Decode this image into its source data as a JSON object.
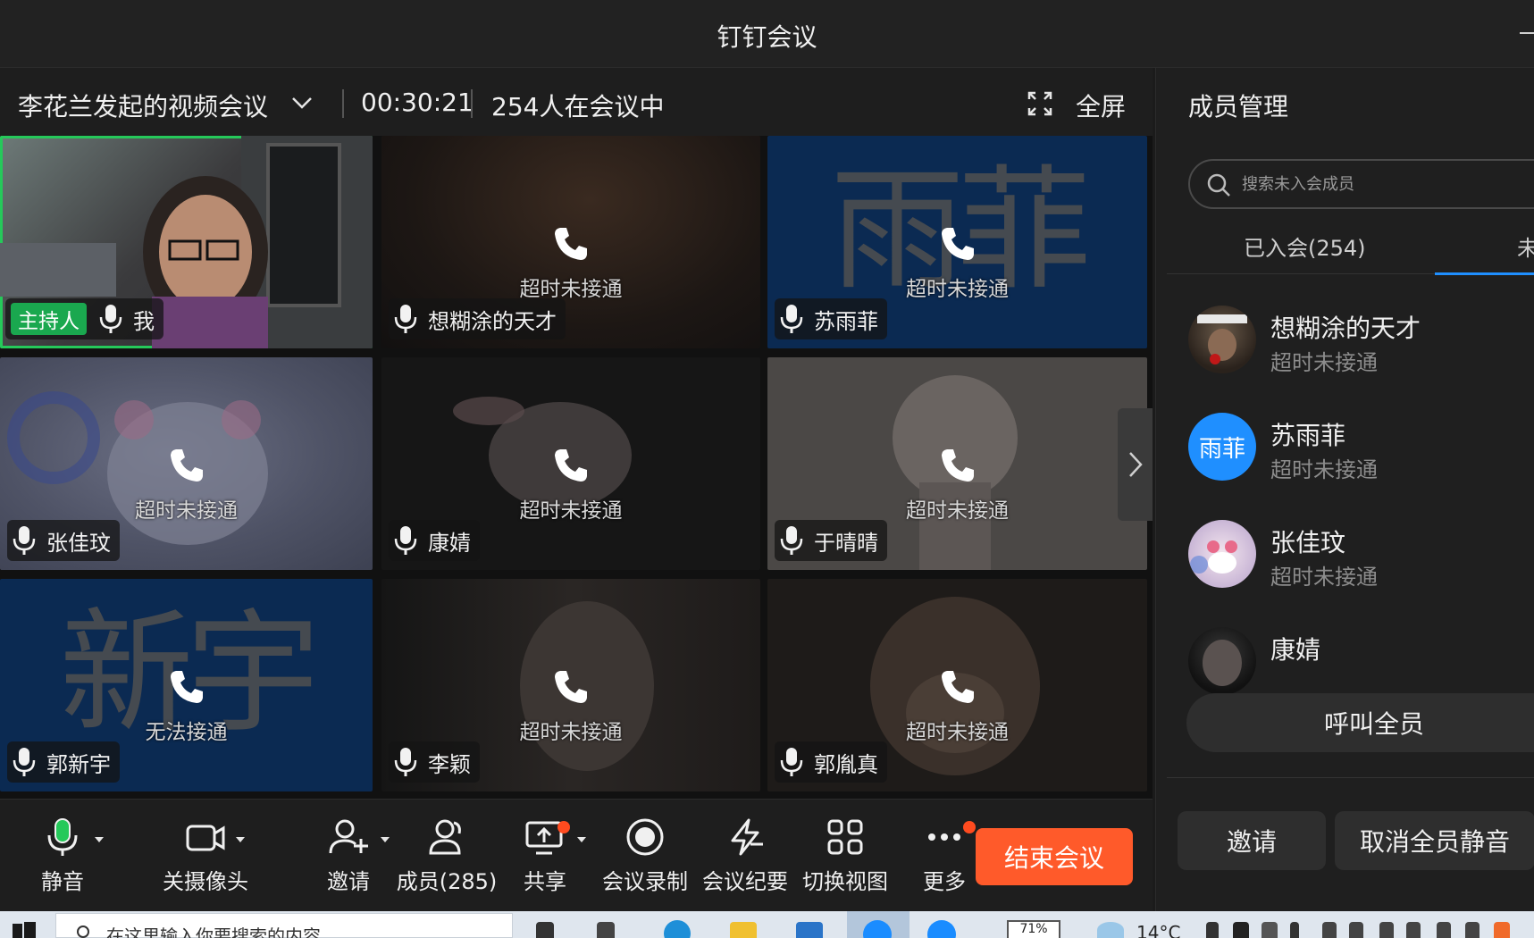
{
  "window": {
    "title": "钉钉会议"
  },
  "meeting": {
    "title": "李花兰发起的视频会议",
    "elapsed": "00:30:21",
    "attendance": "254人在会议中",
    "fullscreen_label": "全屏"
  },
  "tiles": [
    {
      "name": "我",
      "status": "",
      "host_badge": "主持人",
      "big_text": ""
    },
    {
      "name": "想糊涂的天才",
      "status": "超时未接通",
      "big_text": ""
    },
    {
      "name": "苏雨菲",
      "status": "超时未接通",
      "big_text": "雨菲"
    },
    {
      "name": "张佳玟",
      "status": "超时未接通",
      "big_text": ""
    },
    {
      "name": "康婧",
      "status": "超时未接通",
      "big_text": ""
    },
    {
      "name": "于晴晴",
      "status": "超时未接通",
      "big_text": ""
    },
    {
      "name": "郭新宇",
      "status": "无法接通",
      "big_text": "新宇"
    },
    {
      "name": "李颖",
      "status": "超时未接通",
      "big_text": ""
    },
    {
      "name": "郭胤真",
      "status": "超时未接通",
      "big_text": ""
    }
  ],
  "toolbar": {
    "mute": "静音",
    "camera": "关摄像头",
    "invite": "邀请",
    "members": "成员(285)",
    "share": "共享",
    "record": "会议录制",
    "minutes": "会议纪要",
    "view": "切换视图",
    "more": "更多",
    "end": "结束会议"
  },
  "panel": {
    "title": "成员管理",
    "search_placeholder": "搜索未入会成员",
    "tab_joined": "已入会(254)",
    "tab_not_joined": "未",
    "members": [
      {
        "name": "想糊涂的天才",
        "status": "超时未接通"
      },
      {
        "name": "苏雨菲",
        "status": "超时未接通",
        "avatar_text": "雨菲"
      },
      {
        "name": "张佳玟",
        "status": "超时未接通"
      },
      {
        "name": "康婧",
        "status": ""
      }
    ],
    "call_all": "呼叫全员",
    "invite": "邀请",
    "unmute_all": "取消全员静音"
  },
  "taskbar": {
    "search_placeholder": "在这里输入你要搜索的内容",
    "battery": "71%",
    "weather": "14°C"
  },
  "colors": {
    "accent_green": "#25c95a",
    "end_button": "#ff5a2a",
    "tab_indicator": "#1f8fff",
    "avatar_blue": "#1f8fff",
    "notification_dot": "#ff4b1f"
  }
}
